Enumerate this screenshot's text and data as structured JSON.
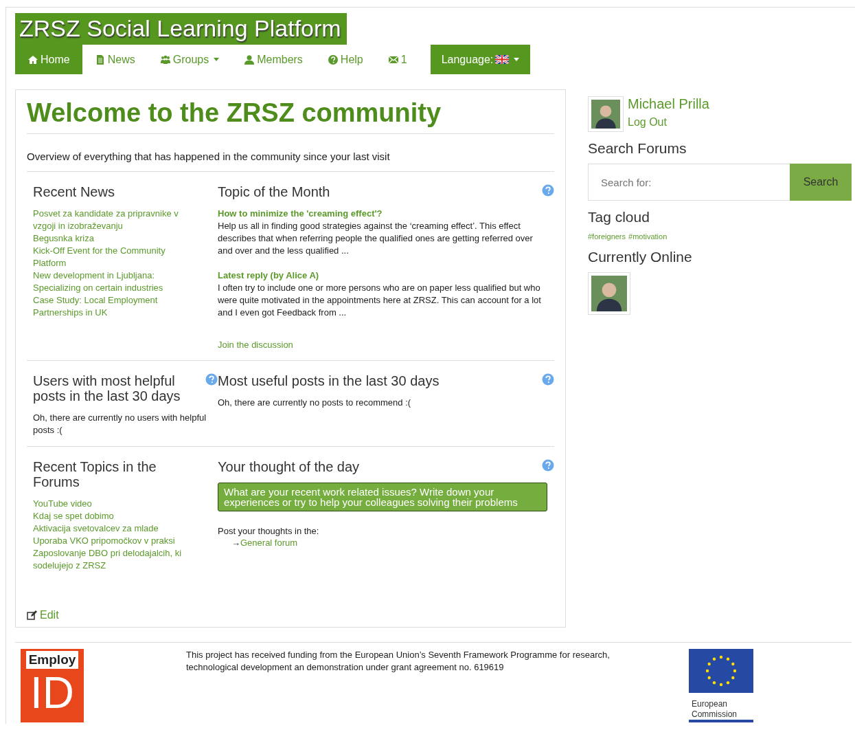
{
  "header": {
    "title": "ZRSZ Social Learning Platform"
  },
  "nav": [
    {
      "label": "Home",
      "kind": "link",
      "selected": true
    },
    {
      "label": "News",
      "kind": "link",
      "selected": false
    },
    {
      "label": "Groups",
      "kind": "dropdown",
      "selected": false
    },
    {
      "label": "Members",
      "kind": "link",
      "selected": false
    },
    {
      "label": "Help",
      "kind": "link",
      "selected": false
    },
    {
      "label": "1",
      "kind": "link",
      "selected": false
    }
  ],
  "language": {
    "label": "Language:"
  },
  "main": {
    "title": "Welcome to the ZRSZ community",
    "intro": "Overview of everything that has happened in the community since your last visit",
    "recent_news": {
      "heading": "Recent News",
      "items": [
        "Posvet za kandidate za pripravnike v vzgoji in izobraževanju",
        "Begusnka kriza",
        "Kick-Off Event for the Community Platform",
        "New development in Ljubljana: Specializing on certain industries",
        "Case Study: Local Employment Partnerships in UK"
      ]
    },
    "topic_of_month": {
      "heading": "Topic of the Month",
      "topic_title": "How to minimize the 'creaming effect'?",
      "topic_text": "Help us all in finding good strategies against the ‘creaming effect’. This effect describes that when referring people the qualified ones are getting referred over and over and the less qualified ...",
      "reply_title": "Latest reply (by Alice A)",
      "reply_text": "I often try to include one or more persons who are on paper less qualified but who were quite motivated in the appointments here at ZRSZ. This can account for a lot and I even got Feedback from ...",
      "link": "Join the discussion"
    },
    "helpful_users": {
      "heading": "Users with most helpful posts in the last 30 days",
      "text": "Oh, there are currently no users with helpful posts :("
    },
    "useful_posts": {
      "heading": "Most useful posts in the last 30 days",
      "text": "Oh, there are currently no posts to recommend :("
    },
    "recent_topics": {
      "heading": "Recent Topics in the Forums",
      "items": [
        "YouTube video",
        "Kdaj se spet dobimo",
        "Aktivacija svetovalcev za mlade",
        "Uporaba VKO pripomočkov v praksi",
        "Zaposlovanje DBO pri delodajalcih, ki sodelujejo z ZRSZ"
      ]
    },
    "thought": {
      "heading": "Your thought of the day",
      "prompt": "What are your recent work related issues? Write down your experiences or try to help your colleagues solving their problems",
      "post_label": "Post your thoughts in the:",
      "arrow": "→",
      "forum_link": "General forum"
    },
    "edit": "Edit"
  },
  "sidebar": {
    "user": {
      "name": "Michael Prilla",
      "logout": "Log Out"
    },
    "search": {
      "heading": "Search Forums",
      "placeholder": "Search for:",
      "button": "Search"
    },
    "tags": {
      "heading": "Tag cloud",
      "items": [
        "#foreigners",
        "#motivation"
      ]
    },
    "online": {
      "heading": "Currently Online"
    }
  },
  "footer": {
    "logo_top": "Employ",
    "logo_big": "ID",
    "text": "This project has received funding from the European Union’s Seventh Framework Programme for research, technological development an demonstration under grant agreement no. 619619",
    "eu_label": "European Commission"
  }
}
